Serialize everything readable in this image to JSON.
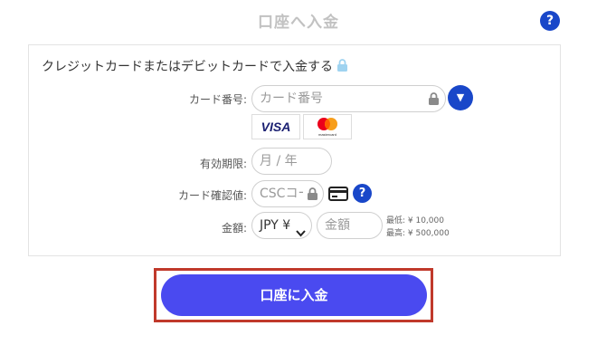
{
  "page": {
    "title": "口座へ入金",
    "help": "?"
  },
  "form": {
    "heading": "クレジットカードまたはデビットカードで入金する",
    "card_number": {
      "label": "カード番号:",
      "placeholder": "カード番号"
    },
    "brands": {
      "visa": "VISA",
      "mastercard": "mastercard"
    },
    "expiry": {
      "label": "有効期限:",
      "placeholder": "月 / 年"
    },
    "csc": {
      "label": "カード確認値:",
      "placeholder": "CSCコード",
      "help": "?"
    },
    "amount": {
      "label": "金額:",
      "currency": "JPY ¥",
      "placeholder": "金額",
      "min": "最低: ¥ 10,000",
      "max": "最高: ¥ 500,000"
    }
  },
  "submit": {
    "label": "口座に入金"
  },
  "colors": {
    "accent": "#1947c9",
    "button": "#4a4af0",
    "highlight": "#c0392b"
  }
}
